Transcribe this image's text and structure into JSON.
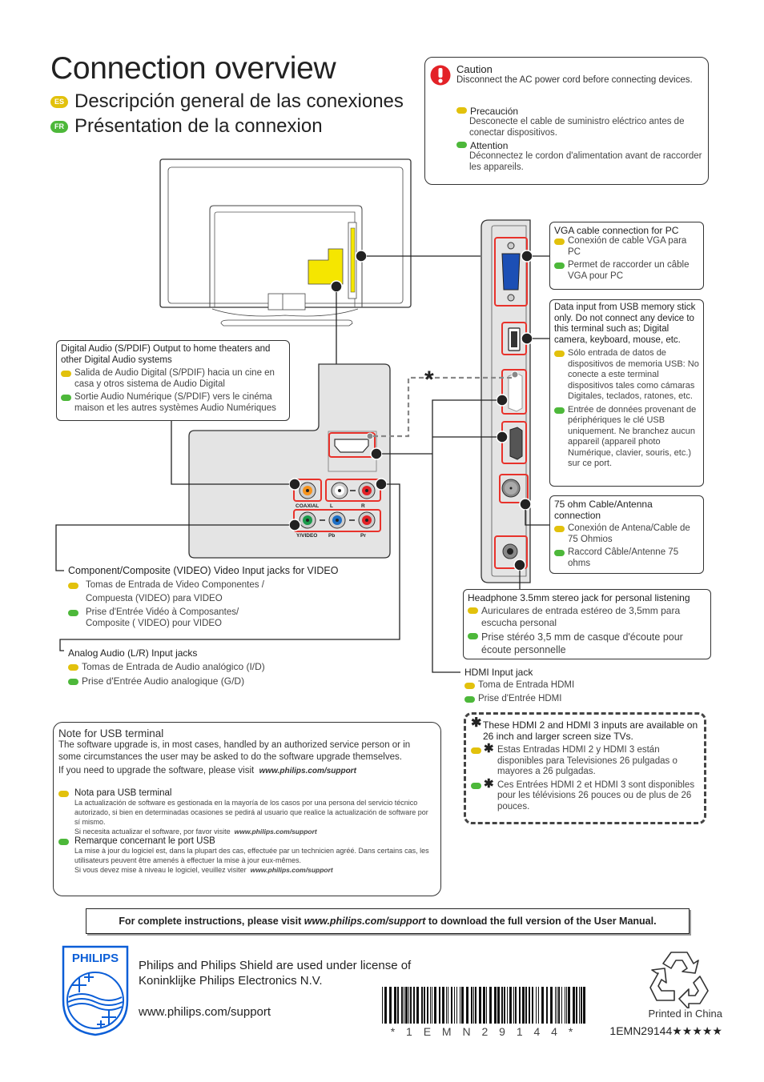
{
  "header": {
    "title": "Connection overview",
    "es_badge": "ES",
    "es_title": "Descripción general de las conexiones",
    "fr_badge": "FR",
    "fr_title": "Présentation de la connexion"
  },
  "caution": {
    "icon": "exclamation-icon",
    "title": "Caution",
    "text": "Disconnect the AC power cord before connecting devices.",
    "es_title": "Precaución",
    "es_text": "Desconecte el cable de suministro eléctrico antes de conectar dispositivos.",
    "fr_title": "Attention",
    "fr_text": "Déconnectez le cordon d'alimentation avant de raccorder les appareils."
  },
  "callouts": {
    "vga": {
      "en": "VGA cable connection for PC",
      "es": "Conexión de cable VGA para PC",
      "fr": "Permet de raccorder un câble VGA pour PC"
    },
    "usb": {
      "en": "Data input from USB memory stick only. Do not connect any device to this terminal such as; Digital camera, keyboard, mouse, etc.",
      "es": "Sólo entrada de datos de dispositivos de memoria USB: No conecte a este terminal dispositivos tales como cámaras Digitales, teclados, ratones, etc.",
      "fr": "Entrée de données provenant de périphériques le clé USB uniquement. Ne branchez aucun appareil (appareil photo Numérique, clavier, souris, etc.) sur ce port."
    },
    "antenna": {
      "en": "75 ohm Cable/Antenna connection",
      "es": "Conexión de Antena/Cable de 75 Ohmios",
      "fr": "Raccord Câble/Antenne 75 ohms"
    },
    "headphone": {
      "en": "Headphone 3.5mm stereo jack for personal listening",
      "es": "Auriculares de entrada estéreo de 3,5mm para escucha personal",
      "fr": "Prise stéréo 3,5 mm de casque d'écoute pour écoute personnelle"
    },
    "hdmi": {
      "en": "HDMI Input jack",
      "es": "Toma de Entrada HDMI",
      "fr": "Prise d'Entrée HDMI"
    },
    "hdmi_note": {
      "en": "These HDMI 2 and HDMI 3 inputs are available on 26 inch and larger screen size TVs.",
      "es": "Estas Entradas HDMI 2 y HDMI 3 están disponibles para Televisiones 26 pulgadas o mayores a 26 pulgadas.",
      "fr": "Ces Entrées HDMI 2 et HDMI 3 sont disponibles pour les télévisions 26 pouces ou de plus de 26 pouces."
    },
    "digital_audio": {
      "en": "Digital Audio (S/PDIF) Output to home theaters and other Digital Audio systems",
      "es": "Salida de Audio Digital (S/PDIF) hacia un cine en casa y otros sistema de Audio Digital",
      "fr": "Sortie Audio Numérique (S/PDIF) vers le cinéma maison et les autres systèmes Audio Numériques"
    },
    "component": {
      "en": "Component/Composite (VIDEO) Video Input jacks for VIDEO",
      "es": "Tomas de Entrada de Video Componentes / Compuesta (VIDEO) para VIDEO",
      "fr": "Prise d'Entrée Vidéo à Composantes/ Composite ( VIDEO) pour VIDEO"
    },
    "analog_audio": {
      "en": "Analog Audio (L/R) Input jacks",
      "es": "Tomas de Entrada de Audio analógico (I/D)",
      "fr": "Prise d'Entrée Audio analogique (G/D)"
    }
  },
  "jack_labels": {
    "coaxial": "COAXIAL",
    "l": "L",
    "r": "R",
    "yvideo": "Y/VIDEO",
    "pb": "Pb",
    "pr": "Pr"
  },
  "usb_note": {
    "title": "Note for USB terminal",
    "text": "The software upgrade is, in most cases, handled by an authorized service person or in some circumstances the user may be asked to do the software upgrade themselves.",
    "visit": "If you need to upgrade the software, please visit",
    "link": "www.philips.com/support",
    "es_title": "Nota para USB terminal",
    "es_text": "La actualización de software es gestionada en la mayoría de los casos por una persona del servicio técnico autorizado, si bien en determinadas ocasiones se pedirá al usuario que realice la actualización de software por sí mismo.",
    "es_visit": "Si necesita actualizar el software, por favor visite",
    "fr_title": "Remarque concernant le port USB",
    "fr_text": "La mise à jour du logiciel est, dans la plupart des cas, effectuée par un technicien agréé. Dans certains cas, les utilisateurs peuvent être amenés à effectuer la mise à jour eux-mêmes.",
    "fr_visit": "Si vous devez mise à niveau le logiciel, veuillez visiter"
  },
  "footer": {
    "instructions_pre": "For complete instructions, please visit",
    "instructions_link": "www.philips.com/support",
    "instructions_post": "to download the full version of the User Manual.",
    "logo_text": "PHILIPS",
    "license_line1": "Philips and Philips Shield are used under license of",
    "license_line2": "Koninklijke Philips Electronics N.V.",
    "website": "www.philips.com/support",
    "barcode_text": "* 1 E M N 2 9 1 4 4 *",
    "printed": "Printed in China",
    "code": "1EMN29144★★★★★"
  },
  "colors": {
    "yellow_es": "#e2c10c",
    "green_fr": "#4db83a",
    "highlight_red": "#e8322b",
    "tv_yellow": "#f5e600",
    "philips_blue": "#0b5ed7"
  }
}
